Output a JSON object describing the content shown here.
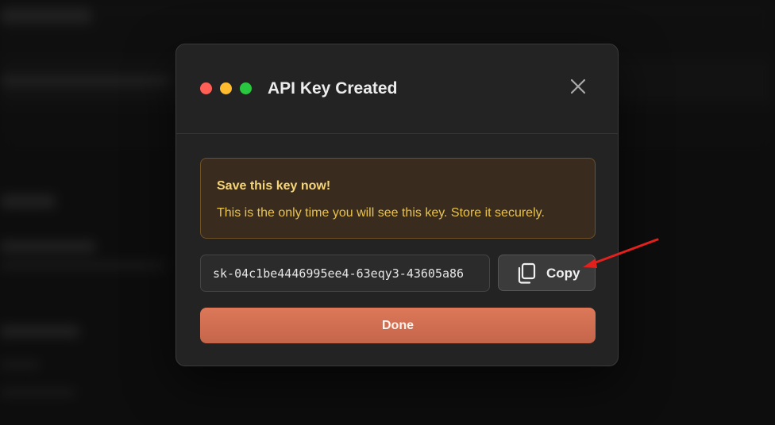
{
  "dialog": {
    "title": "API Key Created",
    "close_icon": "close-icon",
    "window_controls": [
      "red",
      "yellow",
      "green"
    ]
  },
  "warning": {
    "title": "Save this key now!",
    "message": "This is the only time you will see this key. Store it securely."
  },
  "key": {
    "value": "sk-04c1be4446995ee4-63eqy3-43605a86"
  },
  "copy_button": {
    "label": "Copy",
    "icon": "copy-icon"
  },
  "done_button": {
    "label": "Done"
  },
  "annotation": {
    "icon": "arrow-annotation"
  },
  "colors": {
    "traffic_red": "#ff5f57",
    "traffic_yellow": "#febc2e",
    "traffic_green": "#28c840",
    "warning_text": "#e9c24b",
    "warning_bg": "#392c1f",
    "done_accent": "#d46f53",
    "annotation": "#e2201d"
  }
}
